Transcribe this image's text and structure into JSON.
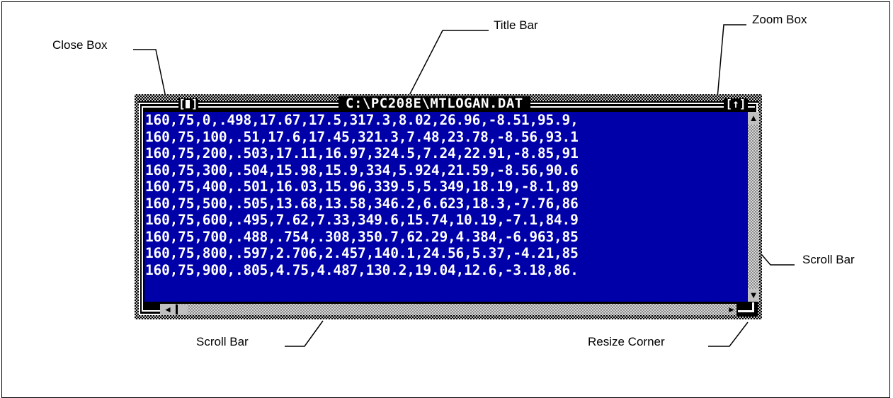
{
  "callouts": {
    "title_bar": "Title Bar",
    "zoom_box": "Zoom Box",
    "close_box": "Close Box",
    "scroll_bar_right": "Scroll Bar",
    "scroll_bar_bottom": "Scroll Bar",
    "resize_corner": "Resize Corner"
  },
  "window": {
    "title": "C:\\PC208E\\MTLOGAN.DAT",
    "close_glyph": "[",
    "zoom_glyph": "[↑]",
    "up_arrow": "▲",
    "down_arrow": "▼",
    "left_arrow": "◄",
    "right_arrow": "►",
    "rows": [
      "160,75,0,.498,17.67,17.5,317.3,8.02,26.96,-8.51,95.9,",
      "160,75,100,.51,17.6,17.45,321.3,7.48,23.78,-8.56,93.1",
      "160,75,200,.503,17.11,16.97,324.5,7.24,22.91,-8.85,91",
      "160,75,300,.504,15.98,15.9,334,5.924,21.59,-8.56,90.6",
      "160,75,400,.501,16.03,15.96,339.5,5.349,18.19,-8.1,89",
      "160,75,500,.505,13.68,13.58,346.2,6.623,18.3,-7.76,86",
      "160,75,600,.495,7.62,7.33,349.6,15.74,10.19,-7.1,84.9",
      "160,75,700,.488,.754,.308,350.7,62.29,4.384,-6.963,85",
      "160,75,800,.597,2.706,2.457,140.1,24.56,5.37,-4.21,85",
      "160,75,900,.805,4.75,4.487,130.2,19.04,12.6,-3.18,86."
    ]
  },
  "colors": {
    "content_bg": "#0000a8",
    "content_text": "#ffffff",
    "frame": "#000000"
  }
}
